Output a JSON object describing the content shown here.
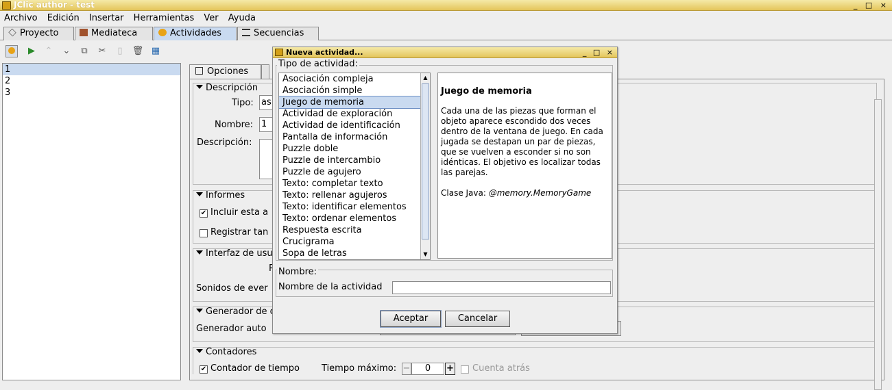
{
  "window": {
    "title": "JClic author - test",
    "controls": "_ □ ×"
  },
  "menu": {
    "items": [
      "Archivo",
      "Edición",
      "Insertar",
      "Herramientas",
      "Ver",
      "Ayuda"
    ]
  },
  "tabs": [
    {
      "label": "Proyecto"
    },
    {
      "label": "Mediateca"
    },
    {
      "label": "Actividades"
    },
    {
      "label": "Secuencias"
    }
  ],
  "toolbar": {
    "icons": [
      "new-activity-icon",
      "play-icon",
      "up-icon",
      "down-icon",
      "copy-icon",
      "cut-icon",
      "paste-icon",
      "delete-icon",
      "grid-icon"
    ]
  },
  "left_list": {
    "items": [
      "1",
      "2",
      "3"
    ],
    "selected": "1"
  },
  "options": {
    "tab_label": "Opciones",
    "sections": {
      "descripcion": {
        "title": "Descripción",
        "tipo_label": "Tipo:",
        "tipo_value": "as",
        "nombre_label": "Nombre:",
        "nombre_value": "1",
        "desc_label": "Descripción:"
      },
      "informes": {
        "title": "Informes",
        "incluir": "Incluir esta a",
        "registrar": "Registrar tan"
      },
      "interfaz": {
        "title": "Interfaz de usua",
        "p_label": "P",
        "sonidos": "Sonidos de ever"
      },
      "generador": {
        "title": "Generador de c",
        "auto_label": "Generador auto"
      },
      "contadores": {
        "title": "Contadores",
        "contador_label": "Contador de tiempo",
        "tiempo_label": "Tiempo máximo:",
        "tiempo_value": "0",
        "cuenta_atras": "Cuenta atrás"
      }
    }
  },
  "dialog": {
    "title": "Nueva actividad...",
    "controls": "_ □ ×",
    "tipo_label": "Tipo de actividad:",
    "activities": [
      "Asociación compleja",
      "Asociación simple",
      "Juego de memoria",
      "Actividad de exploración",
      "Actividad de identificación",
      "Pantalla de información",
      "Puzzle doble",
      "Puzzle de intercambio",
      "Puzzle de agujero",
      "Texto: completar texto",
      "Texto: rellenar agujeros",
      "Texto: identificar elementos",
      "Texto: ordenar elementos",
      "Respuesta escrita",
      "Crucigrama",
      "Sopa de letras"
    ],
    "selected_index": 2,
    "description": {
      "heading": "Juego de memoria",
      "body": "Cada una de las piezas que forman el objeto aparece escondido dos veces dentro de la ventana de juego. En cada jugada se destapan un par de piezas, que se vuelven a esconder si no son idénticas. El objetivo es localizar todas las parejas.",
      "class_label": "Clase Java:",
      "class_value": "@memory.MemoryGame"
    },
    "nombre_section": "Nombre:",
    "nombre_field_label": "Nombre de la actividad",
    "nombre_field_value": "",
    "ok_label": "Aceptar",
    "cancel_label": "Cancelar"
  },
  "colors": {
    "title_bar": "#e4c55a",
    "selection": "#c9daf0",
    "background": "#eeeeee"
  }
}
